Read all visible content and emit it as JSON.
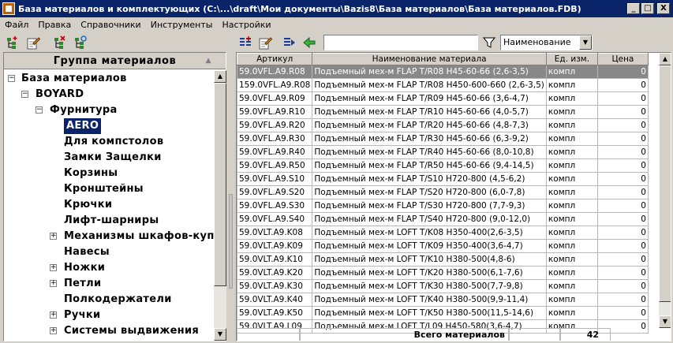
{
  "window": {
    "title": "База материалов и комплектующих  (C:\\...\\draft\\Мои документы\\Bazis8\\База материалов\\База материалов.FDB)"
  },
  "window_buttons": {
    "minimize": "_",
    "maximize": "□",
    "close": "X"
  },
  "menu": [
    "Файл",
    "Правка",
    "Справочники",
    "Инструменты",
    "Настройки"
  ],
  "left_panel": {
    "header": "Группа материалов",
    "sort_glyph": "▲",
    "tree": [
      {
        "label": "База материалов",
        "level": 0,
        "toggle": "−"
      },
      {
        "label": "BOYARD",
        "level": 1,
        "toggle": "−"
      },
      {
        "label": "Фурнитура",
        "level": 2,
        "toggle": "−"
      },
      {
        "label": "AERO",
        "level": 3,
        "toggle": "",
        "selected": true
      },
      {
        "label": "Для компстолов",
        "level": 3,
        "toggle": ""
      },
      {
        "label": "Замки Защелки",
        "level": 3,
        "toggle": ""
      },
      {
        "label": "Корзины",
        "level": 3,
        "toggle": ""
      },
      {
        "label": "Кронштейны",
        "level": 3,
        "toggle": ""
      },
      {
        "label": "Крючки",
        "level": 3,
        "toggle": ""
      },
      {
        "label": "Лифт-шарниры",
        "level": 3,
        "toggle": ""
      },
      {
        "label": "Механизмы шкафов-купе",
        "level": 3,
        "toggle": "+"
      },
      {
        "label": "Навесы",
        "level": 3,
        "toggle": ""
      },
      {
        "label": "Ножки",
        "level": 3,
        "toggle": "+"
      },
      {
        "label": "Петли",
        "level": 3,
        "toggle": "+"
      },
      {
        "label": "Полкодержатели",
        "level": 3,
        "toggle": ""
      },
      {
        "label": "Ручки",
        "level": 3,
        "toggle": "+"
      },
      {
        "label": "Системы выдвижения",
        "level": 3,
        "toggle": "+"
      }
    ]
  },
  "filter_combo": {
    "value": "Наименование"
  },
  "grid": {
    "columns": [
      "Артикул",
      "Наименование материала",
      "Ед. изм.",
      "Цена"
    ],
    "rows": [
      [
        "59.0VFL.A9.R08",
        "Подъемный мех-м FLAP T/R08 H45-60-66 (2,6-3,5)",
        "компл",
        "0"
      ],
      [
        "159.0VFL.A9.R08",
        "Подъемный мех-м FLAP T/R08 H450-600-660 (2,6-3,5)",
        "компл",
        "0"
      ],
      [
        "59.0VFL.A9.R09",
        "Подъемный мех-м FLAP T/R09 H45-60-66 (3,6-4,7)",
        "компл",
        "0"
      ],
      [
        "59.0VFL.A9.R10",
        "Подъемный мех-м FLAP T/R10 H45-60-66 (4,0-5,7)",
        "компл",
        "0"
      ],
      [
        "59.0VFL.A9.R20",
        "Подъемный мех-м FLAP T/R20 H45-60-66 (4,8-7,3)",
        "компл",
        "0"
      ],
      [
        "59.0VFL.A9.R30",
        "Подъемный мех-м FLAP T/R30 H45-60-66 (6,3-9,2)",
        "компл",
        "0"
      ],
      [
        "59.0VFL.A9.R40",
        "Подъемный мех-м FLAP T/R40 H45-60-66 (8,0-10,8)",
        "компл",
        "0"
      ],
      [
        "59.0VFL.A9.R50",
        "Подъемный мех-м FLAP T/R50 H45-60-66 (9,4-14,5)",
        "компл",
        "0"
      ],
      [
        "59.0VFL.A9.S10",
        "Подъемный мех-м FLAP T/S10 H720-800 (4,5-6,2)",
        "компл",
        "0"
      ],
      [
        "59.0VFL.A9.S20",
        "Подъемный мех-м FLAP T/S20 H720-800 (6,0-7,8)",
        "компл",
        "0"
      ],
      [
        "59.0VFL.A9.S30",
        "Подъемный мех-м FLAP T/S30 H720-800 (7,7-9,3)",
        "компл",
        "0"
      ],
      [
        "59.0VFL.A9.S40",
        "Подъемный мех-м FLAP T/S40 H720-800 (9,0-12,0)",
        "компл",
        "0"
      ],
      [
        "59.0VLT.A9.K08",
        "Подъемный мех-м LOFT T/K08 H350-400(2,6-3,5)",
        "компл",
        "0"
      ],
      [
        "59.0VLT.A9.K09",
        "Подъемный мех-м LOFT T/K09 H350-400(3,6-4,7)",
        "компл",
        "0"
      ],
      [
        "59.0VLT.A9.K10",
        "Подъемный мех-м LOFT T/K10 H380-500(4,8-6)",
        "компл",
        "0"
      ],
      [
        "59.0VLT.A9.K20",
        "Подъемный мех-м LOFT T/K20 H380-500(6,1-7,6)",
        "компл",
        "0"
      ],
      [
        "59.0VLT.A9.K30",
        "Подъемный мех-м LOFT T/K30 H380-500(7,7-9,8)",
        "компл",
        "0"
      ],
      [
        "59.0VLT.A9.K40",
        "Подъемный мех-м LOFT T/K40 H380-500(9,9-11,4)",
        "компл",
        "0"
      ],
      [
        "59.0VLT.A9.K50",
        "Подъемный мех-м LOFT T/K50 H380-500(11,5-14,6)",
        "компл",
        "0"
      ],
      [
        "59.0VLT.A9.L09",
        "Подъемный мех-м LOFT T/L09 H450-580(3,6-4,7)",
        "компл",
        "0"
      ]
    ],
    "footer_label": "Всего материалов",
    "footer_count": "42"
  }
}
